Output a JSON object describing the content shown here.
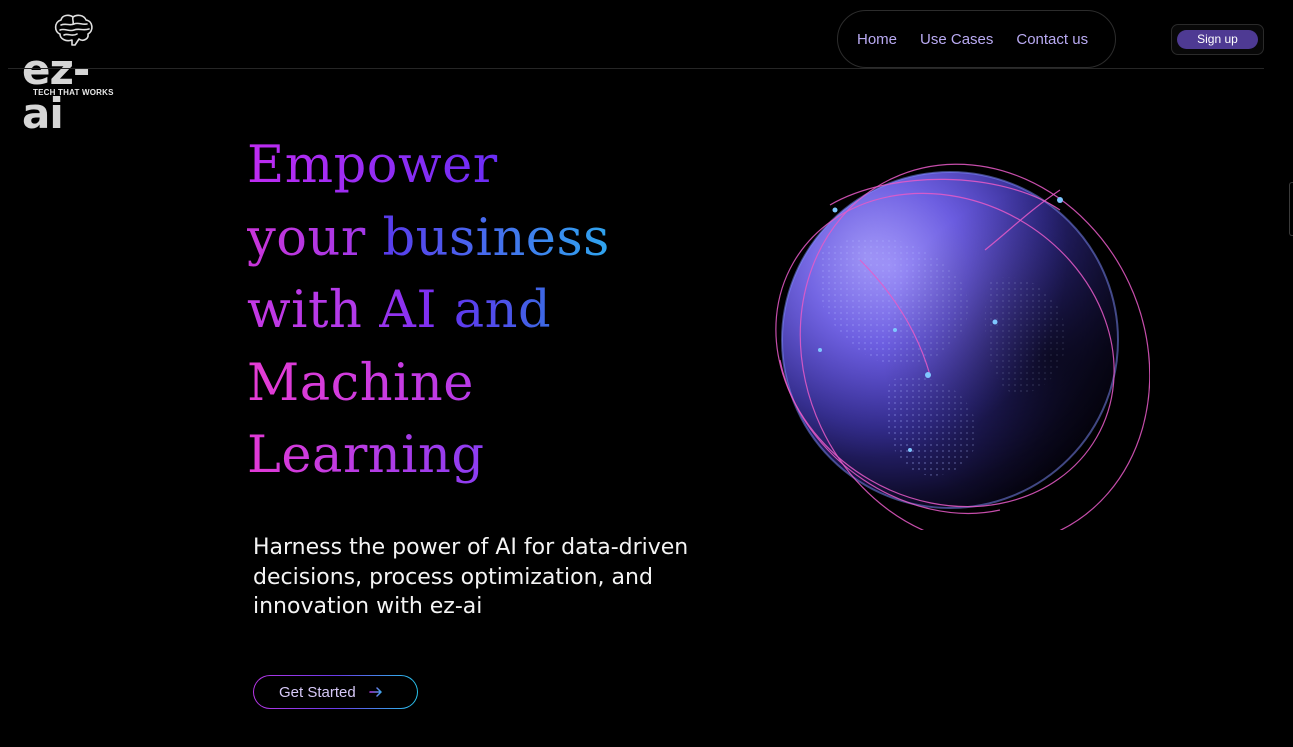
{
  "brand": {
    "name": "ez-ai",
    "tagline": "TECH THAT WORKS",
    "logo_icon": "brain-icon"
  },
  "nav": {
    "items": [
      {
        "label": "Home"
      },
      {
        "label": "Use Cases"
      },
      {
        "label": "Contact us"
      }
    ],
    "signup_label": "Sign up"
  },
  "hero": {
    "title_words": [
      "Empower",
      "your",
      "business",
      "with",
      "AI",
      "and",
      "Machine",
      "Learning"
    ],
    "subtitle": "Harness the power of AI for data-driven decisions, process optimization, and innovation with ez-ai",
    "cta_label": "Get Started",
    "cta_icon": "arrow-right-icon",
    "image": "globe-illustration"
  },
  "colors": {
    "background": "#000000",
    "nav_link": "#b9aaf2",
    "signup_bg": "#4e3a93",
    "gradient_magenta": "#e03ad6",
    "gradient_violet": "#6a2df5",
    "gradient_cyan": "#2fa5ee"
  }
}
